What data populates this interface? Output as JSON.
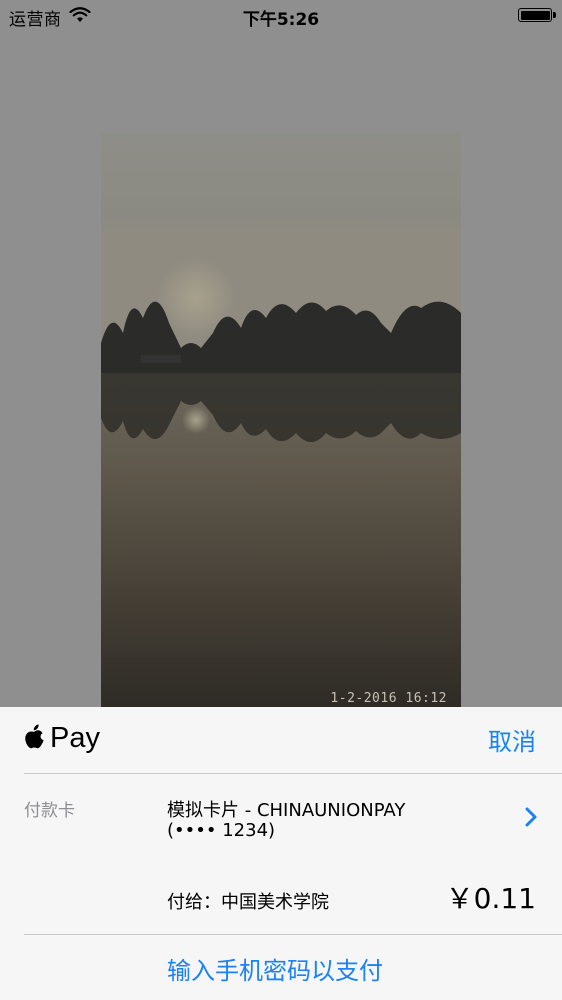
{
  "status_bar": {
    "carrier": "运营商",
    "time": "下午5:26",
    "icons": [
      "wifi-icon",
      "battery-icon"
    ]
  },
  "photo": {
    "timestamp": "1-2-2016 16:12"
  },
  "pay_sheet": {
    "brand_word": "Pay",
    "brand_icon": "apple-logo-icon",
    "cancel_label": "取消",
    "card_label": "付款卡",
    "card_name": "模拟卡片 - CHINAUNIONPAY",
    "card_number": "(•••• 1234)",
    "payee": "付给：中国美术学院",
    "amount": "￥0.11",
    "passcode_label": "输入手机密码以支付"
  },
  "colors": {
    "accent": "#1a82f5",
    "sheet_background": "#f6f6f6",
    "dim_overlay": "#8f8f8f"
  }
}
